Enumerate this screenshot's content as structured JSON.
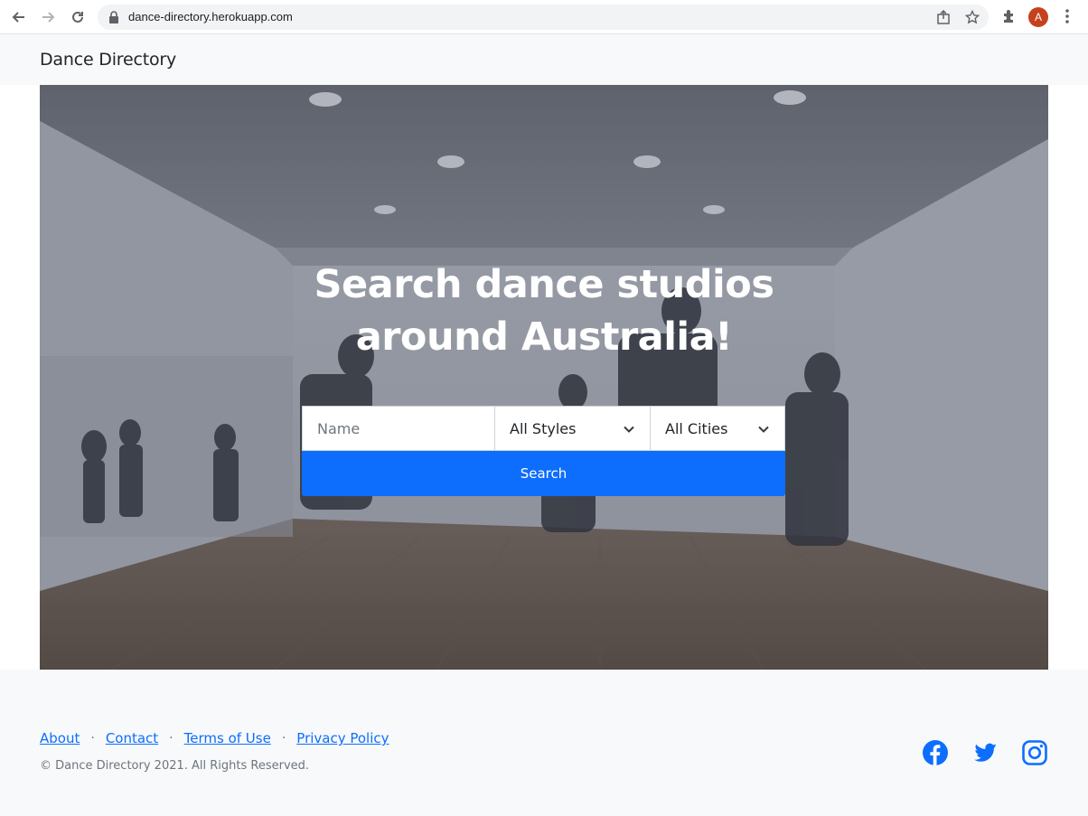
{
  "browser": {
    "url": "dance-directory.herokuapp.com",
    "profile_initial": "A"
  },
  "header": {
    "brand": "Dance Directory"
  },
  "hero": {
    "title_line1": "Search dance studios",
    "title_line2": "around Australia!",
    "name_placeholder": "Name",
    "style_select": "All Styles",
    "city_select": "All Cities",
    "search_label": "Search"
  },
  "footer": {
    "links": [
      "About",
      "Contact",
      "Terms of Use",
      "Privacy Policy"
    ],
    "separator": "·",
    "copyright": "© Dance Directory 2021. All Rights Reserved.",
    "social": [
      "facebook-icon",
      "twitter-icon",
      "instagram-icon"
    ]
  },
  "colors": {
    "primary": "#0d6efd",
    "light_bg": "#f8f9fa",
    "text_muted": "#6c757d"
  }
}
